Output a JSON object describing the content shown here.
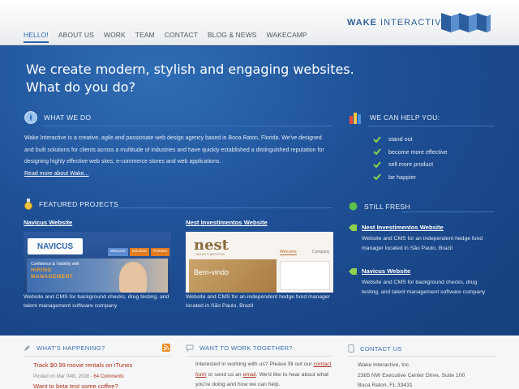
{
  "header": {
    "nav": [
      "HELLO!",
      "ABOUT US",
      "WORK",
      "TEAM",
      "CONTACT",
      "BLOG & NEWS",
      "WAKECAMP"
    ],
    "active_index": 0,
    "brand_bold": "WAKE",
    "brand_rest": " INTERACTIVE"
  },
  "hero": {
    "line1": "We create modern, stylish and engaging websites.",
    "line2": "What do you do?"
  },
  "what_we_do": {
    "heading": "WHAT WE DO",
    "body": "Wake Interactive is a creative, agile and passionate web design agency based in Boca Raton, Florida. We've designed and built solutions for clients across a multitude of industries and have quickly established a distinguished reputation for designing highly effective web sites, e-commerce stores and web applications.",
    "read_more": "Read more about Wake..."
  },
  "help": {
    "heading": "WE CAN HELP YOU:",
    "items": [
      "stand out",
      "become more effective",
      "sell more product",
      "be happier"
    ]
  },
  "featured": {
    "heading": "FEATURED PROJECTS",
    "projects": [
      {
        "title": "Navicus Website",
        "desc": "Website and CMS for background checks, drug testing, and talent management software company",
        "img": {
          "logo": "NAVICUS",
          "tab1": "Welcome",
          "tab2": "Solutions",
          "tab3": "Partners",
          "tagline1": "Confidence & Visibility with",
          "tagline2": "HIRING",
          "tagline3": "MANAGEMENT"
        }
      },
      {
        "title": "Nest Investimentos Website",
        "desc": "Website and CMS for an independent hedge fund manager located in São Paulo, Brazil",
        "img": {
          "logo": "nest",
          "logo_sub": "INVESTIMENTOS",
          "tab1": "Welcome",
          "tab2": "Company",
          "banner": "Bem-vindo"
        }
      }
    ]
  },
  "fresh": {
    "heading": "STILL FRESH",
    "items": [
      {
        "title": "Nest Investimentos Website",
        "desc": "Website and CMS for an independent hedge fund manager located in São Paulo, Brazil"
      },
      {
        "title": "Navicus Website",
        "desc": "Website and CMS for background checks, drug testing, and talent management software company"
      }
    ]
  },
  "footer": {
    "happening": {
      "heading": "WHAT'S HAPPENING?",
      "post1": "Track $0.99 movie rentals on iTunes",
      "post1_meta": "Posted on Mar 04th, 2008 - ",
      "post1_comments": "64 Comments",
      "post2": "Want to beta test some coffee?"
    },
    "work_together": {
      "heading": "WANT TO WORK TOGETHER?",
      "t1": "Interested in working with us? Please fill out our",
      "link1": "contact form",
      "t2": " or send us an ",
      "link2": "email",
      "t3": ". We'd like to hear",
      "t4": "about what you're doing and how we can help."
    },
    "contact": {
      "heading": "CONTACT US",
      "line1": "Wake Interactive, Inc.",
      "line2": "2385 NW Executive Center Drive, Suite 100",
      "line3": "Boca Raton, FL 33431"
    }
  },
  "colors": {
    "blue_main": "#1e4f95",
    "accent_link": "#b0301e",
    "heading_blue": "#3b6fb0"
  }
}
